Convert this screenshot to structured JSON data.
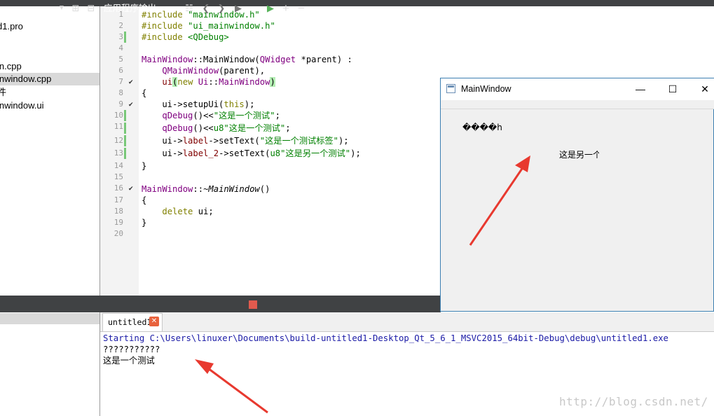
{
  "project_tree": {
    "items": [
      {
        "label": "d1.pro",
        "selected": false
      },
      {
        "label": "in.cpp",
        "selected": false
      },
      {
        "label": "inwindow.cpp",
        "selected": true
      },
      {
        "label": "件",
        "selected": false
      },
      {
        "label": "inwindow.ui",
        "selected": false
      }
    ]
  },
  "editor": {
    "line_numbers": [
      "1",
      "2",
      "3",
      "4",
      "5",
      "6",
      "7",
      "8",
      "9",
      "10",
      "11",
      "12",
      "13",
      "14",
      "15",
      "16",
      "17",
      "18",
      "19",
      "20"
    ],
    "lines": {
      "l1a": "#include ",
      "l1b": "\"mainwindow.h\"",
      "l2a": "#include ",
      "l2b": "\"ui_mainwindow.h\"",
      "l3a": "#include ",
      "l3b": "<QDebug>",
      "l5a": "MainWindow",
      "l5b": "::MainWindow(",
      "l5c": "QWidget",
      "l5d": " *parent) :",
      "l6a": "    ",
      "l6b": "QMainWindow",
      "l6c": "(parent),",
      "l7a": "    ",
      "l7b": "ui",
      "l7c": "(",
      "l7d": "new",
      "l7e": " Ui",
      "l7f": "::",
      "l7g": "MainWindow",
      "l7h": ")",
      "l8": "{",
      "l9a": "    ui->setupUi(",
      "l9b": "this",
      "l9c": ");",
      "l10a": "    ",
      "l10b": "qDebug",
      "l10c": "()<<",
      "l10d": "\"这是一个测试\"",
      "l10e": ";",
      "l11a": "    ",
      "l11b": "qDebug",
      "l11c": "()<<",
      "l11d": "u8\"这是一个测试\"",
      "l11e": ";",
      "l12a": "    ui->",
      "l12b": "label",
      "l12c": "->setText(",
      "l12d": "\"这是一个测试标签\"",
      "l12e": ");",
      "l13a": "    ui->",
      "l13b": "label_2",
      "l13c": "->setText(",
      "l13d": "u8\"这是另一个测试\"",
      "l13e": ");",
      "l14": "}",
      "l16a": "MainWindow",
      "l16b": "::",
      "l16c": "~MainWindow",
      "l16d": "()",
      "l17": "{",
      "l18a": "    ",
      "l18b": "delete",
      "l18c": " ui;",
      "l19": "}"
    }
  },
  "output_pane": {
    "title": "应用程序输出",
    "tab_label": "untitled1",
    "lines": [
      "Starting C:\\Users\\linuxer\\Documents\\build-untitled1-Desktop_Qt_5_6_1_MSVC2015_64bit-Debug\\debug\\untitled1.exe",
      "???????????",
      "这是一个测试"
    ]
  },
  "main_window": {
    "title": "MainWindow",
    "label_1": "����h",
    "label_2": "这是另一个"
  },
  "watermark": "http://blog.csdn.net/",
  "colors": {
    "accent_arrow": "#e8392f",
    "stop_button": "#e05a4e",
    "run_debug_button": "#58b35a"
  }
}
